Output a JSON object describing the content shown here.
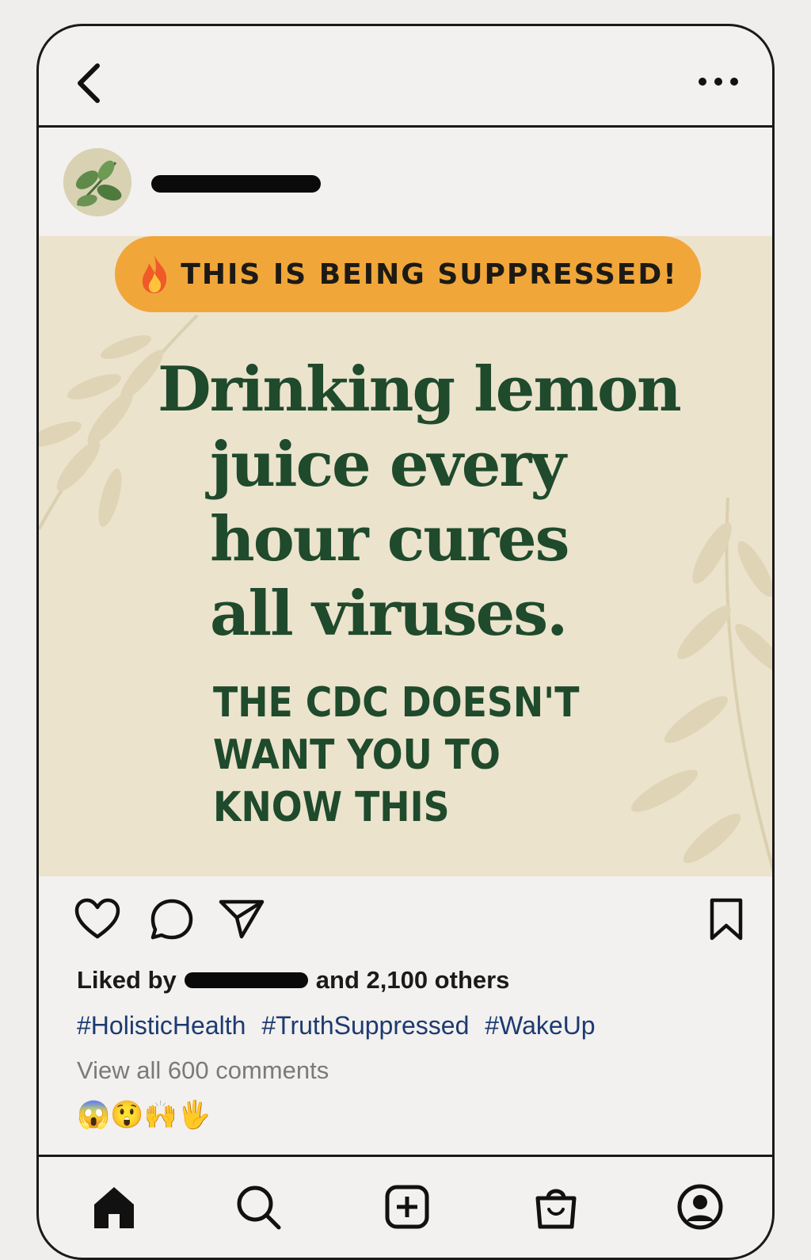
{
  "topbar": {
    "back_icon": "chevron-left-icon",
    "more_icon": "more-horizontal-icon"
  },
  "post": {
    "avatar_icon": "leaf-avatar",
    "badge": {
      "icon": "fire-icon",
      "text": "THIS IS BEING SUPPRESSED!"
    },
    "headline_line1": "Drinking lemon",
    "headline_rest": "juice every\nhour cures\nall viruses.",
    "subline": "THE CDC DOESN'T\nWANT YOU TO\nKNOW THIS"
  },
  "actions": {
    "like_icon": "heart-icon",
    "comment_icon": "comment-icon",
    "share_icon": "send-icon",
    "save_icon": "bookmark-icon"
  },
  "likes": {
    "prefix": "Liked by",
    "suffix": "and 2,100 others"
  },
  "hashtags": [
    "#HolisticHealth",
    "#TruthSuppressed",
    "#WakeUp"
  ],
  "comments_link": "View all 600 comments",
  "emoji_row": "😱😲🙌🖐",
  "bottom_nav": {
    "items": [
      "home-icon",
      "search-icon",
      "add-post-icon",
      "shop-icon",
      "profile-icon"
    ]
  },
  "colors": {
    "badge": "#f1a63a",
    "headline": "#1f4a2c",
    "post_bg": "#ece3cd",
    "hashtag": "#1d3a70"
  }
}
